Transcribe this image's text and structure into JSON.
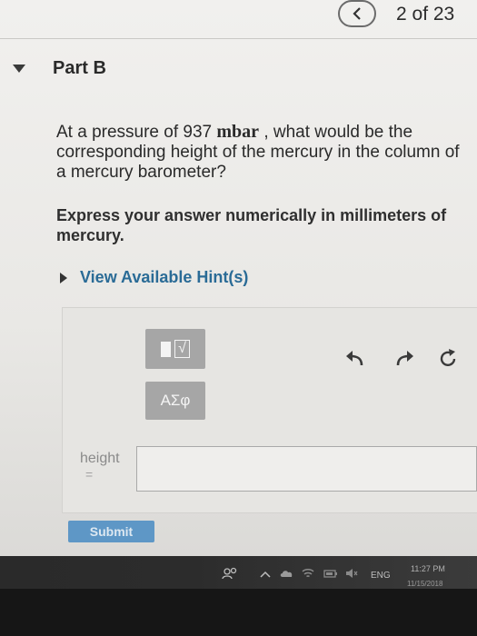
{
  "nav": {
    "prev_icon": "chevron-left-icon",
    "counter": "2 of 23"
  },
  "part": {
    "title": "Part B"
  },
  "question": {
    "text_before": "At a pressure of 937 ",
    "unit": "mbar",
    "text_after": " , what would be the corresponding height of the mercury in the column of a mercury barometer?",
    "instruction": "Express your answer numerically in millimeters of mercury."
  },
  "hints": {
    "label": "View Available Hint(s)"
  },
  "toolbar": {
    "greek_label": "ΑΣφ",
    "undo_icon": "undo-icon",
    "redo_icon": "redo-icon",
    "reset_icon": "reset-icon"
  },
  "answer": {
    "label": "height",
    "equals": "=",
    "value": "",
    "submit_label": "Submit"
  },
  "taskbar": {
    "language": "ENG",
    "time": "11:27 PM",
    "date": "11/15/2018"
  },
  "colors": {
    "link": "#2a6b96",
    "submit": "#5e97c6",
    "tool_button": "#a6a6a6"
  }
}
